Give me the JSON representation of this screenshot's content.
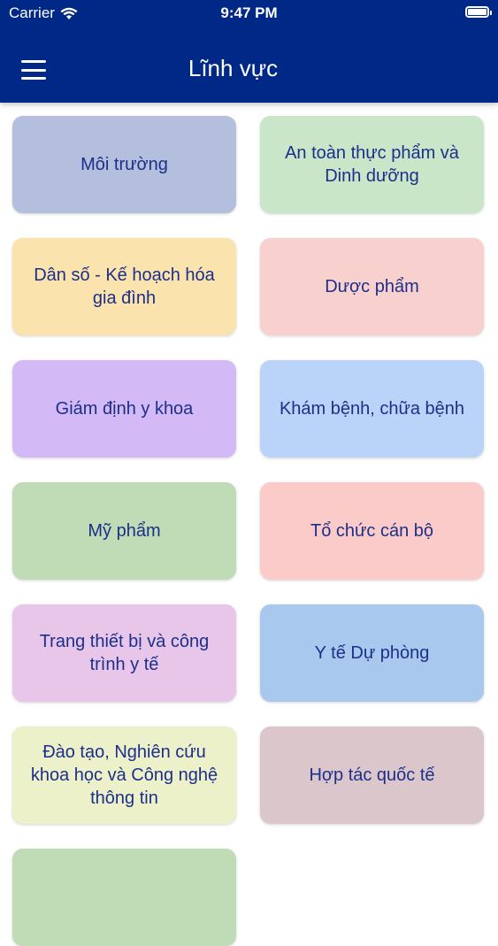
{
  "status_bar": {
    "carrier": "Carrier",
    "time": "9:47 PM"
  },
  "nav": {
    "title": "Lĩnh vực",
    "menu_icon": "hamburger-menu-icon"
  },
  "categories": [
    {
      "label": "Môi trường",
      "color": "#b3bfdc"
    },
    {
      "label": "An toàn thực phẩm và Dinh dưỡng",
      "color": "#c9e6c9"
    },
    {
      "label": "Dân số - Kế hoạch hóa gia đình",
      "color": "#fbe3ad"
    },
    {
      "label": "Dược phẩm",
      "color": "#f8d1ce"
    },
    {
      "label": "Giám định y khoa",
      "color": "#d3b9f6"
    },
    {
      "label": "Khám bệnh, chữa bệnh",
      "color": "#bad4f9"
    },
    {
      "label": "Mỹ phẩm",
      "color": "#bfdcb7"
    },
    {
      "label": "Tổ chức cán bộ",
      "color": "#fbcbc9"
    },
    {
      "label": "Trang thiết bị và công trình y tế",
      "color": "#e7c6ea"
    },
    {
      "label": "Y tế Dự phòng",
      "color": "#a8c8ed"
    },
    {
      "label": "Đào tạo, Nghiên cứu khoa học và Công nghệ thông tin",
      "color": "#ecf1c9"
    },
    {
      "label": "Hợp tác quốc tế",
      "color": "#dbc7cb"
    },
    {
      "label": "",
      "color": "#bfdcb7"
    }
  ]
}
